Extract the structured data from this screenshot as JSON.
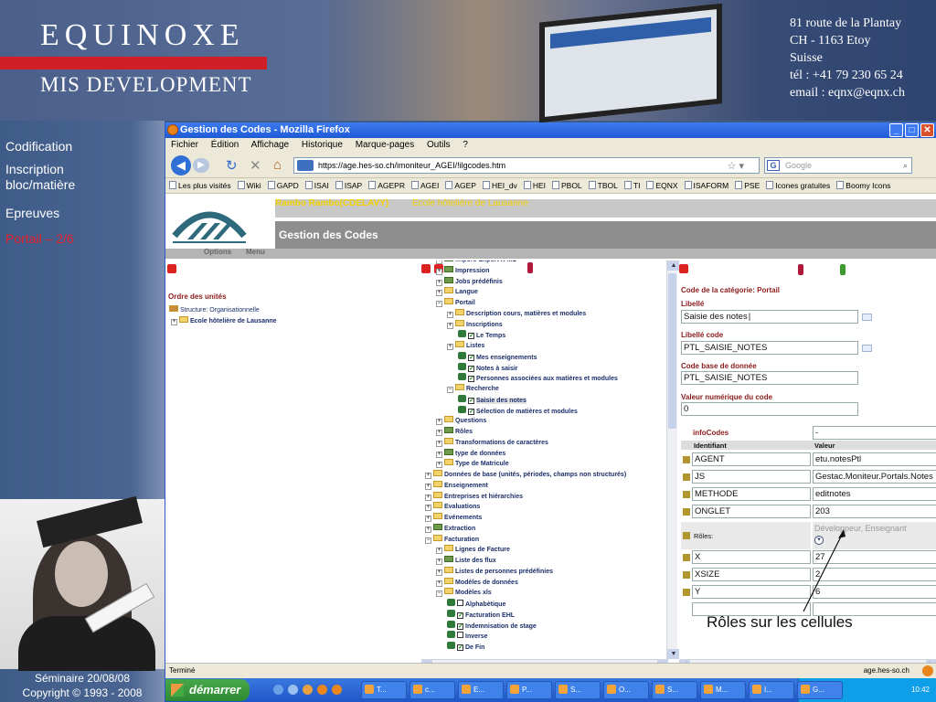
{
  "banner": {
    "brand_line1": "EQUINOXE",
    "brand_line2": "MIS DEVELOPMENT",
    "address": [
      "81 route de la Plantay",
      "CH - 1163 Etoy",
      "Suisse",
      "tél : +41 79 230 65 24",
      "email : eqnx@eqnx.ch"
    ]
  },
  "sidebar": {
    "items": [
      {
        "label": "Codification",
        "active": false
      },
      {
        "label": "Inscription bloc/matière",
        "active": false
      },
      {
        "label": "Epreuves",
        "active": false
      },
      {
        "label": "Portail – 2/6",
        "active": true
      }
    ],
    "footer_line1": "Séminaire 20/08/08",
    "footer_line2": "Copyright © 1993 - 2008"
  },
  "browser": {
    "title": "Gestion des Codes - Mozilla Firefox",
    "menu": [
      "Fichier",
      "Édition",
      "Affichage",
      "Historique",
      "Marque-pages",
      "Outils",
      "?"
    ],
    "url": "https://age.hes-so.ch/imoniteur_AGEI/!ilgcodes.htm",
    "search_placeholder": "Google",
    "bookmarks": [
      "Les plus visités",
      "Wiki",
      "GAPD",
      "ISAI",
      "ISAP",
      "AGEPR",
      "AGEI",
      "AGEP",
      "HEI_dv",
      "HEI",
      "PBOL",
      "TBOL",
      "TI",
      "EQNX",
      "ISAFORM",
      "PSE",
      "Icones gratuites",
      "Boomy Icons"
    ],
    "status_left": "Terminé",
    "status_right": "age.hes-so.ch"
  },
  "app": {
    "user": "Rambo Rambo(CDELAVY)",
    "school": "Ecole hôtelière de Lausanne",
    "page_title": "Gestion des Codes",
    "options_label": "Options",
    "menu_label": "Menu"
  },
  "left_pane": {
    "title": "Ordre des unités",
    "structure": "Structure: Organisationnelle",
    "school": "Ecole hôtelière de Lausanne"
  },
  "tree": [
    {
      "label": "Import/ Export X-ML",
      "level": 1,
      "kind": "green"
    },
    {
      "label": "Impression",
      "level": 1,
      "kind": "green"
    },
    {
      "label": "Jobs prédéfinis",
      "level": 1,
      "kind": "green"
    },
    {
      "label": "Langue",
      "level": 1,
      "kind": "folder"
    },
    {
      "label": "Portail",
      "level": 1,
      "kind": "folder"
    },
    {
      "label": "Description cours, matières et modules",
      "level": 2,
      "kind": "folder"
    },
    {
      "label": "Inscriptions",
      "level": 2,
      "kind": "folder"
    },
    {
      "label": "Le Temps",
      "level": 3,
      "kind": "check"
    },
    {
      "label": "Listes",
      "level": 2,
      "kind": "folder"
    },
    {
      "label": "Mes enseignements",
      "level": 3,
      "kind": "check"
    },
    {
      "label": "Notes à saisir",
      "level": 3,
      "kind": "check"
    },
    {
      "label": "Personnes associées aux matières et modules",
      "level": 3,
      "kind": "check"
    },
    {
      "label": "Recherche",
      "level": 2,
      "kind": "folder"
    },
    {
      "label": "Saisie des notes",
      "level": 3,
      "kind": "check",
      "selected": true
    },
    {
      "label": "Sélection de matières et modules",
      "level": 3,
      "kind": "check"
    },
    {
      "label": "Questions",
      "level": 1,
      "kind": "folder"
    },
    {
      "label": "Rôles",
      "level": 1,
      "kind": "green"
    },
    {
      "label": "Transformations de caractères",
      "level": 1,
      "kind": "folder"
    },
    {
      "label": "type de données",
      "level": 1,
      "kind": "green"
    },
    {
      "label": "Type de Matricule",
      "level": 1,
      "kind": "folder"
    },
    {
      "label": "Données de base (unités, périodes, champs non structurés)",
      "level": 0,
      "kind": "folder"
    },
    {
      "label": "Enseignement",
      "level": 0,
      "kind": "folder"
    },
    {
      "label": "Entreprises et hiérarchies",
      "level": 0,
      "kind": "folder"
    },
    {
      "label": "Evaluations",
      "level": 0,
      "kind": "folder"
    },
    {
      "label": "Evénements",
      "level": 0,
      "kind": "folder"
    },
    {
      "label": "Extraction",
      "level": 0,
      "kind": "green"
    },
    {
      "label": "Facturation",
      "level": 0,
      "kind": "folder"
    },
    {
      "label": "Lignes de Facture",
      "level": 1,
      "kind": "folder"
    },
    {
      "label": "Liste des flux",
      "level": 1,
      "kind": "green"
    },
    {
      "label": "Listes de personnes prédéfinies",
      "level": 1,
      "kind": "folder"
    },
    {
      "label": "Modèles de données",
      "level": 1,
      "kind": "folder"
    },
    {
      "label": "Modèles xls",
      "level": 1,
      "kind": "folder"
    },
    {
      "label": "Alphabètique",
      "level": 2,
      "kind": "check0"
    },
    {
      "label": "Facturation EHL",
      "level": 2,
      "kind": "check"
    },
    {
      "label": "Indemnisation de stage",
      "level": 2,
      "kind": "check"
    },
    {
      "label": "Inverse",
      "level": 2,
      "kind": "check0"
    },
    {
      "label": "De Fin",
      "level": 2,
      "kind": "check"
    }
  ],
  "detail": {
    "category_label": "Code de la catégorie: Portail",
    "libelle_label": "Libellé",
    "libelle_value": "Saisie des notes",
    "libelle_code_label": "Libellé code",
    "libelle_code_value": "PTL_SAISIE_NOTES",
    "code_db_label": "Code base de donnée",
    "code_db_value": "PTL_SAISIE_NOTES",
    "numeric_label": "Valeur numérique du code",
    "numeric_value": "0",
    "infocodes_label": "infoCodes",
    "infocodes_value": "-",
    "col_id": "Identifiant",
    "col_val": "Valeur",
    "rows": [
      {
        "id": "AGENT",
        "val": "etu.notesPtl"
      },
      {
        "id": "JS",
        "val": "Gestac.Moniteur.Portals.Notes"
      },
      {
        "id": "METHODE",
        "val": "editnotes"
      },
      {
        "id": "ONGLET",
        "val": "203"
      }
    ],
    "roles_label": "Rôles:",
    "roles_value": "Développeur, Enseignant",
    "rows2": [
      {
        "id": "X",
        "val": "27"
      },
      {
        "id": "XSIZE",
        "val": "2"
      },
      {
        "id": "Y",
        "val": "6"
      }
    ]
  },
  "annotation": "Rôles sur les cellules",
  "taskbar": {
    "start": "démarrer",
    "items": [
      "T...",
      "c...",
      "E...",
      "P...",
      "S...",
      "O...",
      "S...",
      "M...",
      "I...",
      "G..."
    ],
    "clock": "10:42"
  }
}
